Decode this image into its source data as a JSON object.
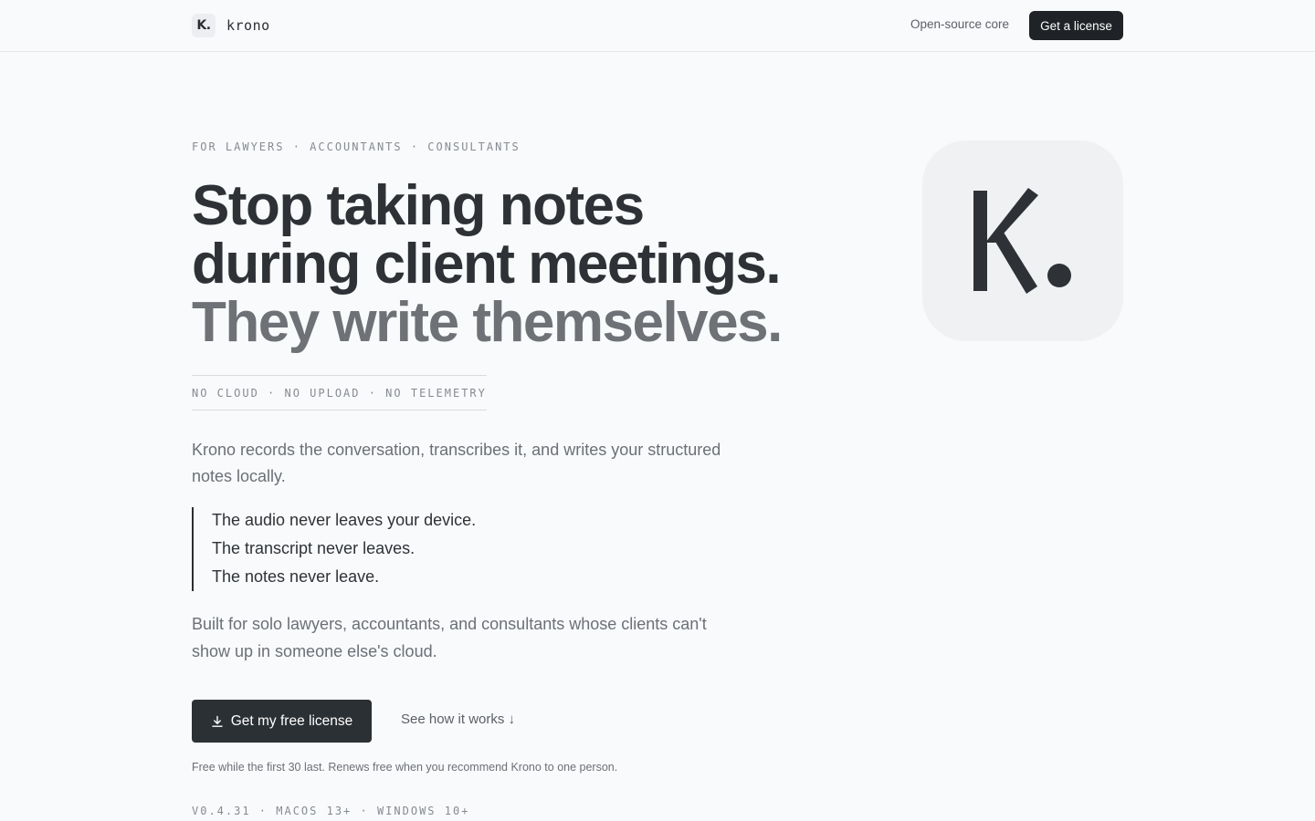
{
  "header": {
    "brand_mark": "K.",
    "brand_name": "krono",
    "nav_link": "Open-source core",
    "nav_button": "Get a license"
  },
  "hero": {
    "eyebrow": "FOR LAWYERS · ACCOUNTANTS · CONSULTANTS",
    "headline_line1": "Stop taking notes",
    "headline_line2": "during client meetings.",
    "headline_line3": "They write themselves.",
    "tagline": "NO CLOUD · NO UPLOAD · NO TELEMETRY",
    "lead": "Krono records the conversation, transcribes it, and writes your structured notes locally.",
    "quote_lines": [
      "The audio never leaves your device.",
      "The transcript never leaves.",
      "The notes never leave."
    ],
    "sub": "Built for solo lawyers, accountants, and consultants whose clients can't show up in someone else's cloud.",
    "cta_label": "Get my free license",
    "secondary_label": "See how it works ↓",
    "fine_print": "Free while the first 30 last. Renews free when you recommend Krono to one person.",
    "version": "V0.4.31 · MACOS 13+ · WINDOWS 10+"
  },
  "icons": {
    "cta_icon": "download-icon",
    "app_icon": "krono-app-icon"
  },
  "colors": {
    "background": "#f9fafc",
    "text": "#2e3236",
    "muted": "#6e7175",
    "button_dark": "#1f2226",
    "app_icon_bg": "#eff1f3"
  }
}
